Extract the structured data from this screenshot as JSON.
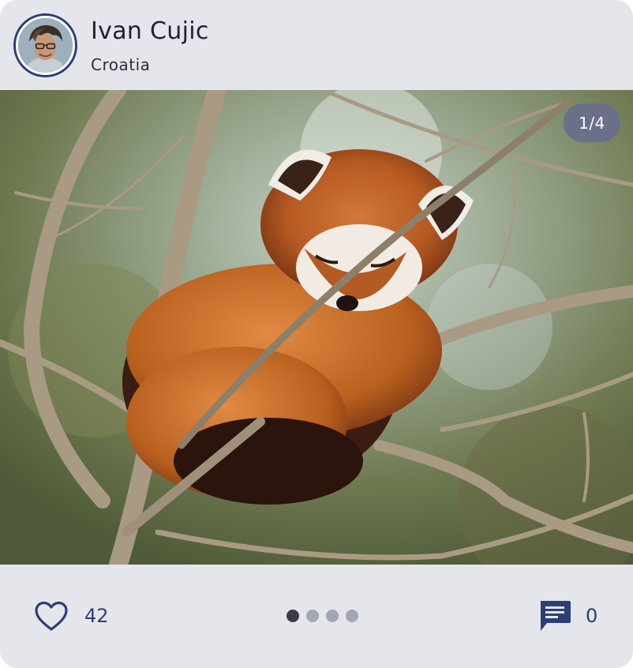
{
  "post": {
    "author_name": "Ivan Cujic",
    "author_location": "Croatia",
    "image_counter": "1/4",
    "likes": "42",
    "comments": "0",
    "carousel": {
      "total": 4,
      "active_index": 0
    }
  },
  "icons": {
    "like": "heart-outline-icon",
    "comment": "chat-bubble-icon"
  },
  "colors": {
    "card_background": "#e5e6ec",
    "accent": "#2b3f74",
    "counter_badge": "#6b6f88",
    "dot_active": "#3a3d49",
    "dot_inactive": "#a4a7b3"
  }
}
